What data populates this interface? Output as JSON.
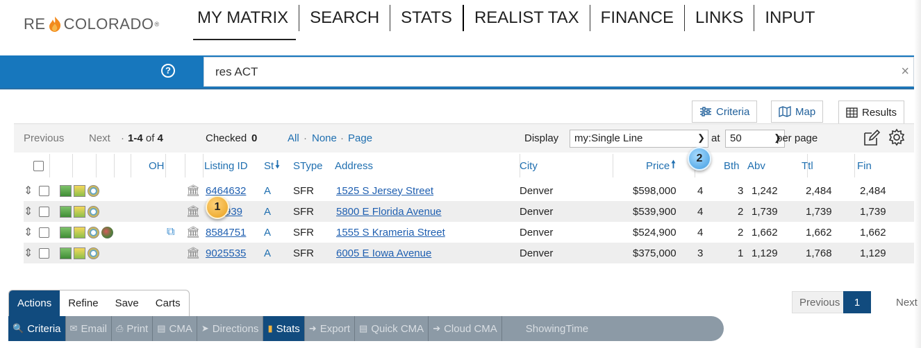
{
  "logo": {
    "re": "RE",
    "colorado": "COLORADO",
    "reg": "®"
  },
  "nav": [
    "MY MATRIX",
    "SEARCH",
    "STATS",
    "REALIST TAX",
    "FINANCE",
    "LINKS",
    "INPUT"
  ],
  "search": {
    "help": "?",
    "value": "res ACT",
    "clear": "×"
  },
  "view_tabs": {
    "criteria": "Criteria",
    "map": "Map",
    "results": "Results"
  },
  "toolbar": {
    "previous": "Previous",
    "next": "Next",
    "range": "1-4",
    "of_label": "of",
    "total": "4",
    "checked_label": "Checked",
    "checked_count": "0",
    "all": "All",
    "none": "None",
    "page": "Page",
    "sep": "·",
    "display_label": "Display",
    "display_value": "my:Single Line",
    "at_label": "at",
    "per_page_value": "50",
    "per_page_label": "per page"
  },
  "columns": {
    "oh": "OH",
    "listing_id": "Listing ID",
    "st": "St",
    "stype": "SType",
    "address": "Address",
    "city": "City",
    "price": "Price",
    "bth": "Bth",
    "abv": "Abv",
    "ttl": "Ttl",
    "fin": "Fin"
  },
  "rows": [
    {
      "listing_id": "6464632",
      "st": "A",
      "stype": "SFR",
      "address": "1525 S Jersey Street",
      "city": "Denver",
      "price": "$598,000",
      "beds": "4",
      "bth": "3",
      "abv": "1,242",
      "ttl": "2,484",
      "fin": "2,484"
    },
    {
      "listing_id": "939",
      "st": "A",
      "stype": "SFR",
      "address": "5800 E Florida Avenue",
      "city": "Denver",
      "price": "$539,900",
      "beds": "4",
      "bth": "2",
      "abv": "1,739",
      "ttl": "1,739",
      "fin": "1,739"
    },
    {
      "listing_id": "8584751",
      "st": "A",
      "stype": "SFR",
      "address": "1555 S Krameria Street",
      "city": "Denver",
      "price": "$524,900",
      "beds": "4",
      "bth": "2",
      "abv": "1,662",
      "ttl": "1,662",
      "fin": "1,662"
    },
    {
      "listing_id": "9025535",
      "st": "A",
      "stype": "SFR",
      "address": "6005 E Iowa Avenue",
      "city": "Denver",
      "price": "$375,000",
      "beds": "3",
      "bth": "1",
      "abv": "1,129",
      "ttl": "1,768",
      "fin": "1,129"
    }
  ],
  "badges": {
    "one": "1",
    "two": "2"
  },
  "action_tabs": [
    "Actions",
    "Refine",
    "Save",
    "Carts"
  ],
  "action_buttons": [
    "Criteria",
    "Email",
    "Print",
    "CMA",
    "Directions",
    "Stats",
    "Export",
    "Quick CMA",
    "Cloud CMA",
    "ShowingTime"
  ],
  "pager": {
    "previous": "Previous",
    "current": "1",
    "next": "Next"
  }
}
